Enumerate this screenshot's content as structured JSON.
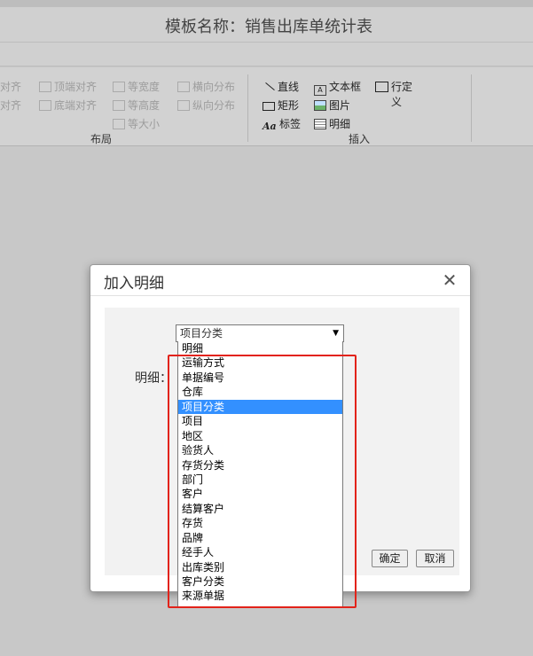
{
  "window": {
    "title": "模板名称：销售出库单统计表"
  },
  "ribbon": {
    "layout_group": {
      "label": "布局",
      "items": [
        {
          "label": "对齐",
          "icon": "align-left-icon"
        },
        {
          "label": "顶端对齐",
          "icon": "align-top-icon"
        },
        {
          "label": "等宽度",
          "icon": "same-width-icon"
        },
        {
          "label": "横向分布",
          "icon": "distribute-horizontal-icon"
        },
        {
          "label": "对齐",
          "icon": "align-right-icon"
        },
        {
          "label": "底端对齐",
          "icon": "align-bottom-icon"
        },
        {
          "label": "等高度",
          "icon": "same-height-icon"
        },
        {
          "label": "纵向分布",
          "icon": "distribute-vertical-icon"
        },
        {
          "label": "等大小",
          "icon": "same-size-icon"
        }
      ]
    },
    "insert_group": {
      "label": "插入",
      "items": [
        {
          "label": "直线",
          "icon": "line-icon"
        },
        {
          "label": "文本框",
          "icon": "textbox-icon"
        },
        {
          "label": "行定义",
          "icon": "row-define-icon"
        },
        {
          "label": "矩形",
          "icon": "rectangle-icon"
        },
        {
          "label": "图片",
          "icon": "image-icon"
        },
        {
          "label": "标签",
          "icon": "label-icon"
        },
        {
          "label": "明细",
          "icon": "detail-icon"
        }
      ]
    }
  },
  "dialog": {
    "title": "加入明细",
    "close_glyph": "✕",
    "field_label": "明细：",
    "select_value": "项目分类",
    "options": [
      "明细",
      "运输方式",
      "单据编号",
      "仓库",
      "项目分类",
      "项目",
      "地区",
      "验货人",
      "存货分类",
      "部门",
      "客户",
      "结算客户",
      "存货",
      "品牌",
      "经手人",
      "出库类别",
      "客户分类",
      "来源单据"
    ],
    "selected_option": "项目分类",
    "ok_label": "确定",
    "cancel_label": "取消"
  },
  "colors": {
    "highlight": "#3390ff",
    "annotation_border": "#e2231a"
  }
}
